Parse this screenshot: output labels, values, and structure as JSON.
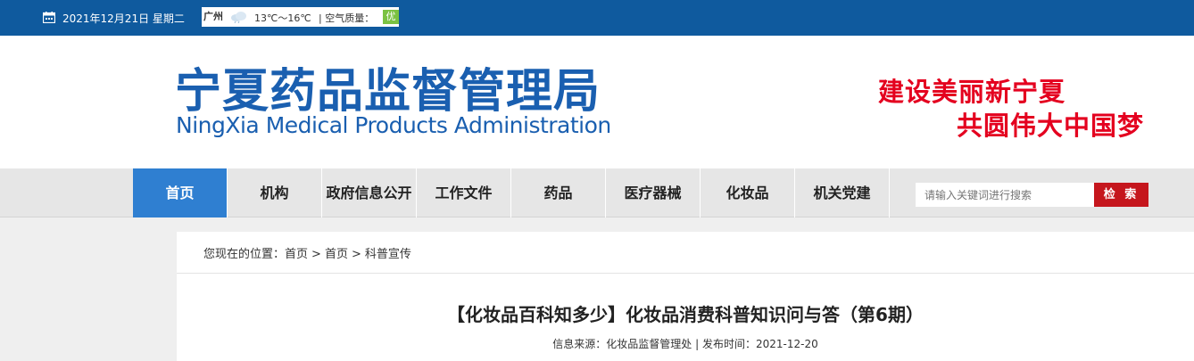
{
  "topbar": {
    "date": "2021年12月21日 星期二",
    "weather": {
      "city": "广州",
      "icon": "cloud-icon",
      "temperature": "13℃～16℃",
      "air_quality_label": "空气质量：",
      "air_quality_value": "优"
    }
  },
  "header": {
    "logo_cn": "宁夏药品监督管理局",
    "logo_en": "NingXia Medical Products Administration",
    "slogan_line1": "建设美丽新宁夏",
    "slogan_line2": "共圆伟大中国梦"
  },
  "nav": {
    "items": [
      {
        "label": "首页",
        "active": true
      },
      {
        "label": "机构"
      },
      {
        "label": "政府信息公开"
      },
      {
        "label": "工作文件"
      },
      {
        "label": "药品"
      },
      {
        "label": "医疗器械"
      },
      {
        "label": "化妆品"
      },
      {
        "label": "机关党建"
      }
    ],
    "search_placeholder": "请输入关键词进行搜索",
    "search_button": "检 索"
  },
  "breadcrumb": {
    "prefix": "您现在的位置：",
    "items": [
      "首页",
      "首页",
      "科普宣传"
    ]
  },
  "article": {
    "title": "【化妆品百科知多少】化妆品消费科普知识问与答（第6期）",
    "source_label": "信息来源：",
    "source": "化妆品监督管理处",
    "date_label": "发布时间：",
    "date": "2021-12-20"
  },
  "colors": {
    "topbar": "#0f5a9e",
    "brand_blue": "#1a5fb0",
    "slogan_red": "#e4001f",
    "nav_active": "#2f7fd1",
    "search_button": "#c5161d"
  }
}
